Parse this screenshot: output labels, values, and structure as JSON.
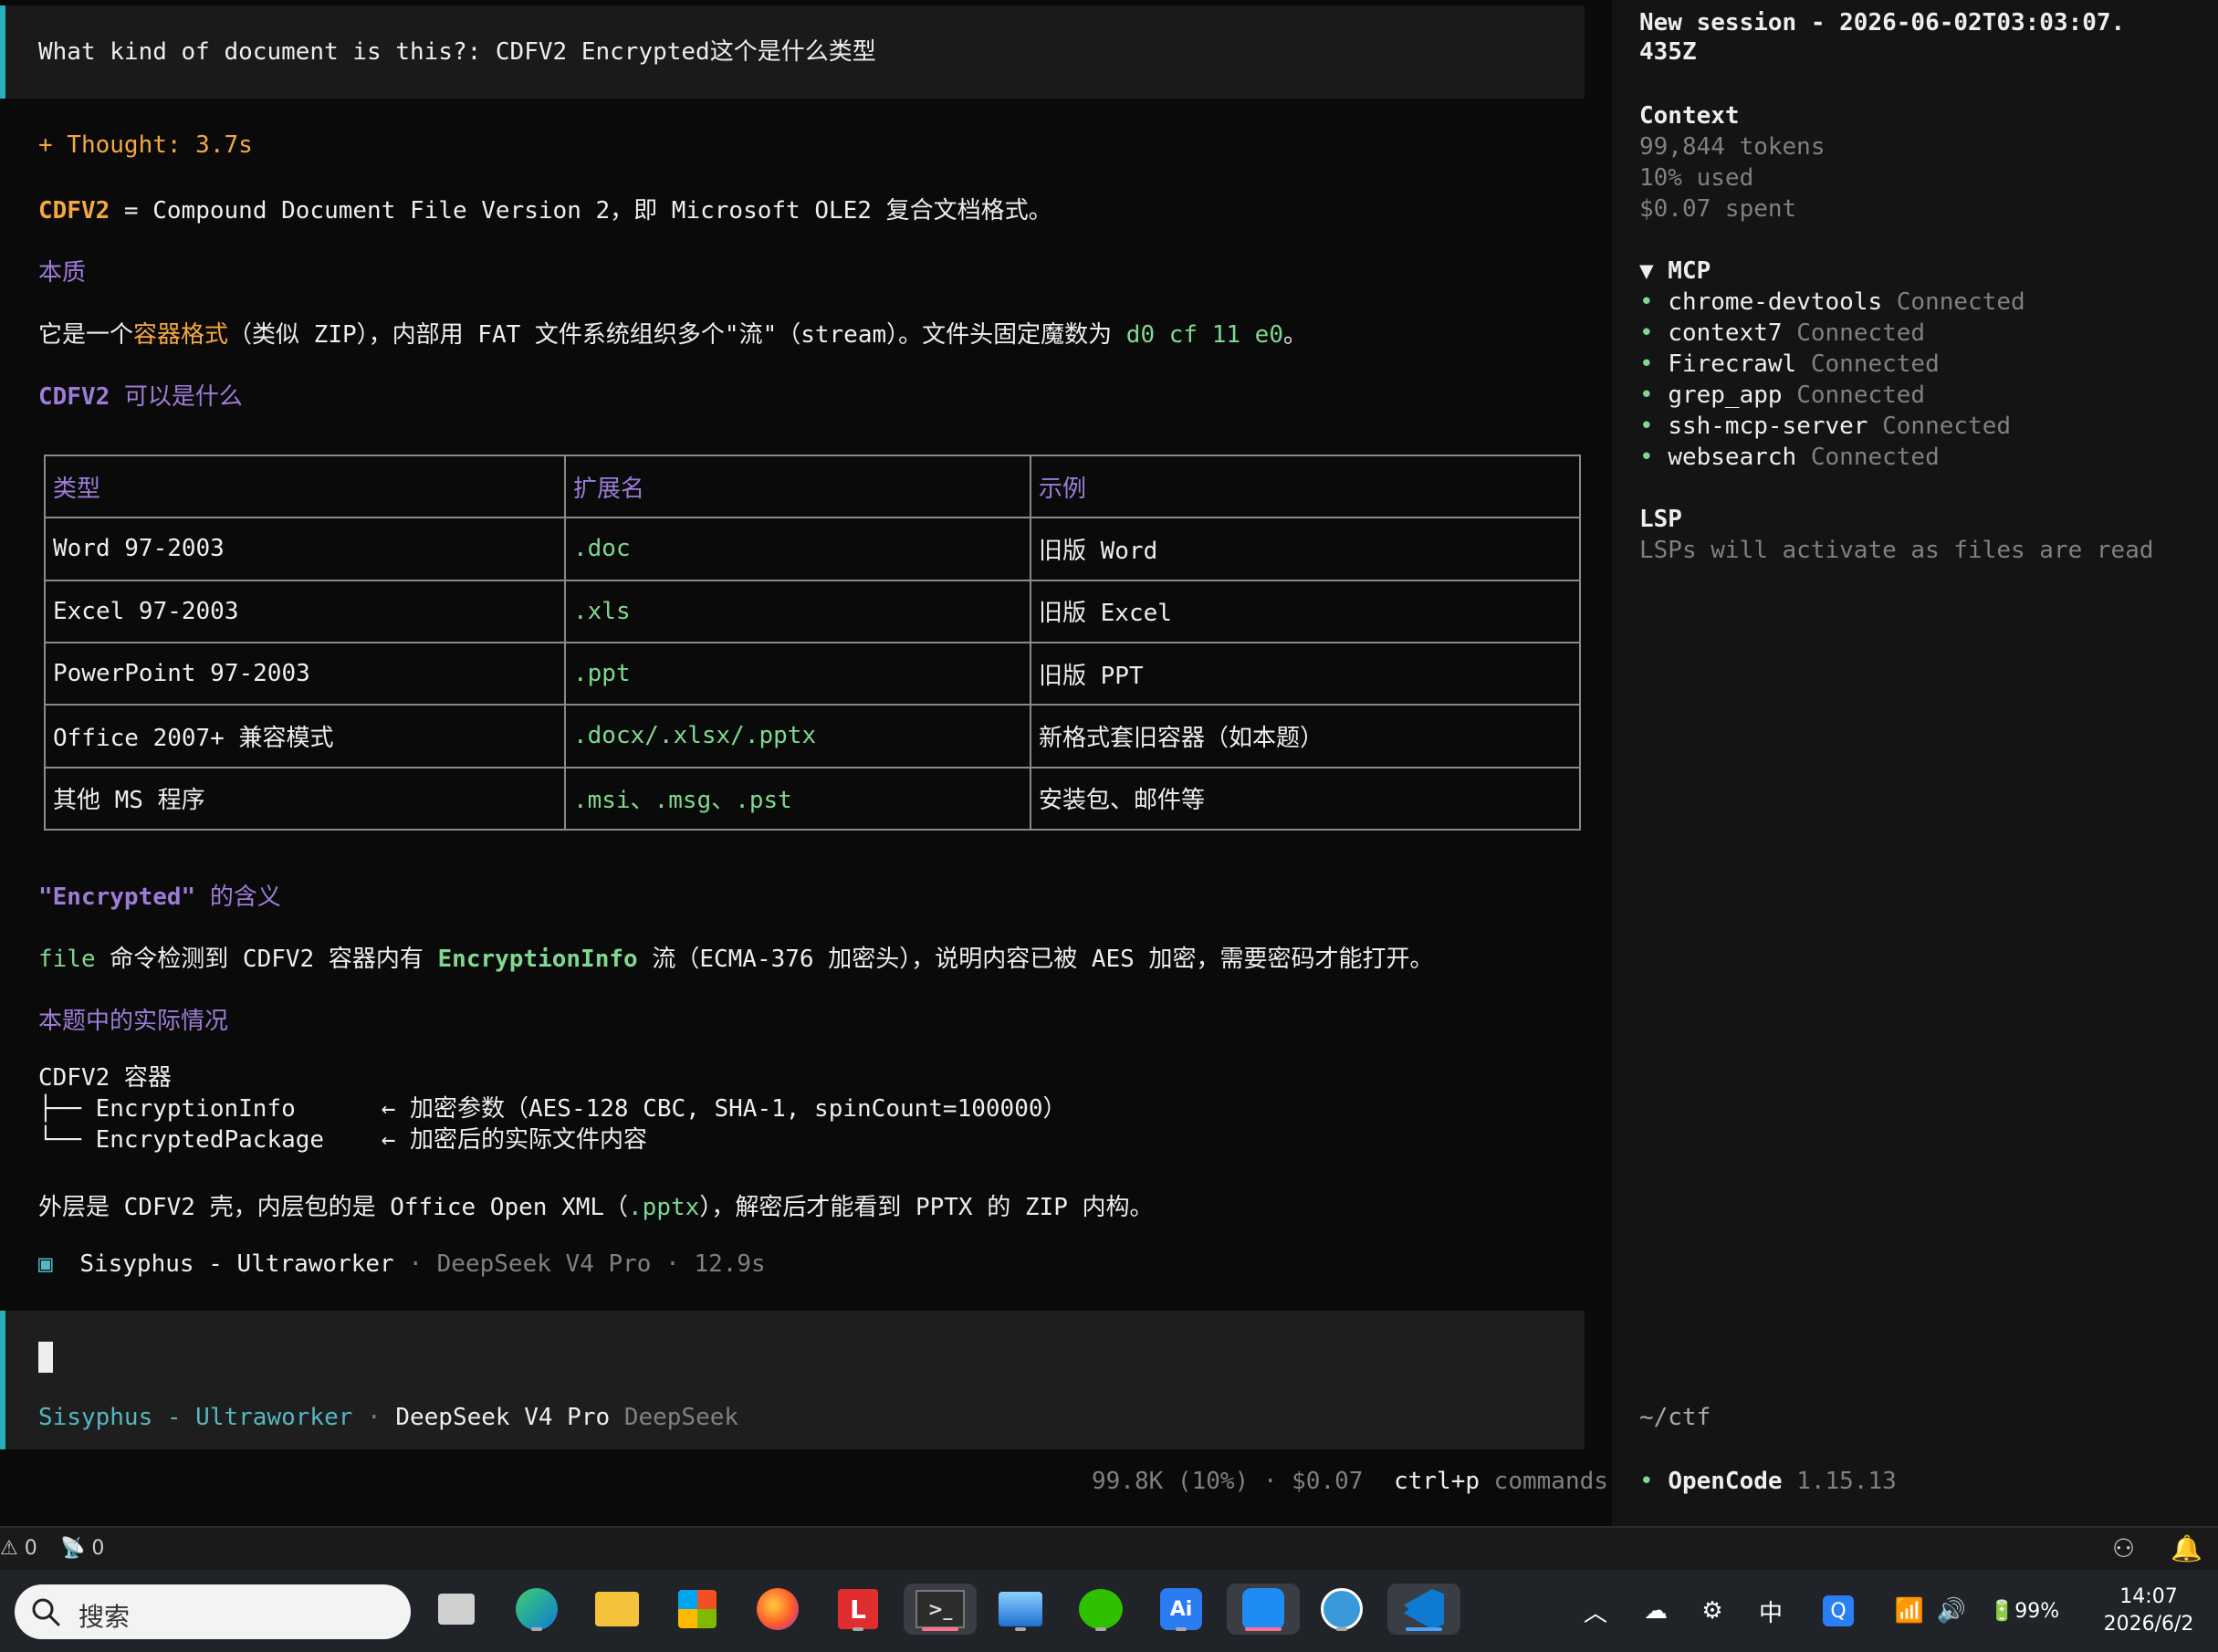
{
  "conversation": {
    "user_message": "What kind of document is this?: CDFV2 Encrypted这个是什么类型",
    "thought_label": "+ Thought: 3.7s",
    "intro": {
      "term": "CDFV2",
      "rest": " = Compound Document File Version 2，即 Microsoft OLE2 复合文档格式。"
    },
    "heading_nature": "本质",
    "nature_text": {
      "prefix": "它是一个",
      "highlight": "容器格式",
      "middle": "（类似 ZIP），内部用 FAT 文件系统组织多个\"流\"（stream）。文件头固定魔数为 ",
      "magic": "d0 cf 11 e0",
      "suffix": "。"
    },
    "heading_can_be": {
      "term": "CDFV2",
      "rest": " 可以是什么"
    },
    "table": {
      "headers": [
        "类型",
        "扩展名",
        "示例"
      ],
      "rows": [
        [
          "Word 97-2003",
          ".doc",
          "旧版 Word"
        ],
        [
          "Excel 97-2003",
          ".xls",
          "旧版 Excel"
        ],
        [
          "PowerPoint 97-2003",
          ".ppt",
          "旧版 PPT"
        ],
        [
          "Office 2007+ 兼容模式",
          ".docx/.xlsx/.pptx",
          "新格式套旧容器（如本题）"
        ],
        [
          "其他 MS 程序",
          ".msi、.msg、.pst",
          "安装包、邮件等"
        ]
      ]
    },
    "heading_encrypted": {
      "term": "\"Encrypted\"",
      "rest": " 的含义"
    },
    "encrypted_text": {
      "cmd": "file",
      "part1": " 命令检测到 CDFV2 容器内有 ",
      "stream": "EncryptionInfo",
      "part2": " 流（ECMA-376 加密头），说明内容已被 AES 加密，需要密码才能打开。"
    },
    "heading_actual": "本题中的实际情况",
    "tree": {
      "root": "CDFV2 容器",
      "line1": "├── EncryptionInfo      ← 加密参数（AES-128 CBC, SHA-1, spinCount=100000）",
      "line2": "└── EncryptedPackage    ← 加密后的实际文件内容"
    },
    "conclusion": {
      "part1": "外层是 CDFV2 壳，内层包的是 Office Open XML（",
      "ext": ".pptx",
      "part2": "），解密后才能看到 PPTX 的 ZIP 内构。"
    },
    "footer": {
      "icon": "▣",
      "agent": "Sisyphus - Ultraworker",
      "model": "DeepSeek V4 Pro",
      "time": "12.9s",
      "sep": "·"
    }
  },
  "input": {
    "agent_label": "Sisyphus - Ultraworker",
    "sep": "·",
    "model": "DeepSeek V4 Pro",
    "provider": "DeepSeek"
  },
  "bottom_status": {
    "tokens": "99.8K (10%)",
    "sep": "·",
    "cost": "$0.07",
    "shortcut": "ctrl+p",
    "shortcut_label": "commands"
  },
  "sidebar": {
    "session_title_line1": "New session - 2026-06-02T03:03:07.",
    "session_title_line2": "435Z",
    "context_heading": "Context",
    "context_tokens": "99,844 tokens",
    "context_used": "10% used",
    "context_spent": "$0.07 spent",
    "mcp_heading": "▼ MCP",
    "mcp_servers": [
      {
        "name": "chrome-devtools",
        "status": "Connected"
      },
      {
        "name": "context7",
        "status": "Connected"
      },
      {
        "name": "Firecrawl",
        "status": "Connected"
      },
      {
        "name": "grep_app",
        "status": "Connected"
      },
      {
        "name": "ssh-mcp-server",
        "status": "Connected"
      },
      {
        "name": "websearch",
        "status": "Connected"
      }
    ],
    "lsp_heading": "LSP",
    "lsp_text": "LSPs will activate as files are read",
    "cwd": "~/ctf",
    "app_name": "OpenCode",
    "app_version": "1.15.13"
  },
  "status_bar": {
    "warnings": "⚠ 0",
    "ports": "📡 0"
  },
  "taskbar": {
    "search_placeholder": "搜索",
    "ime": "中",
    "battery": "99%",
    "time": "14:07",
    "date": "2026/6/2"
  },
  "colors": {
    "accent": "#27b1b7",
    "orange": "#f5a742",
    "purple": "#9d7cd8",
    "green": "#7fd88f"
  }
}
